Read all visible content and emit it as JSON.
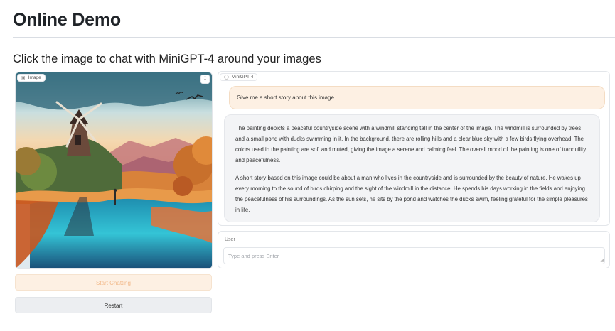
{
  "header": {
    "title": "Online Demo",
    "subtitle": "Click the image to chat with MiniGPT-4 around your images"
  },
  "image_panel": {
    "label": "Image",
    "label_icon": "image-icon",
    "download_icon": "download-icon"
  },
  "buttons": {
    "start": "Start Chatting",
    "restart": "Restart"
  },
  "chat": {
    "label": "MiniGPT-4",
    "label_icon": "chat-icon",
    "user_message": "Give me a short story about this image.",
    "bot_paragraphs": [
      "The painting depicts a peaceful countryside scene with a windmill standing tall in the center of the image. The windmill is surrounded by trees and a small pond with ducks swimming in it. In the background, there are rolling hills and a clear blue sky with a few birds flying overhead. The colors used in the painting are soft and muted, giving the image a serene and calming feel. The overall mood of the painting is one of tranquility and peacefulness.",
      "A short story based on this image could be about a man who lives in the countryside and is surrounded by the beauty of nature. He wakes up every morning to the sound of birds chirping and the sight of the windmill in the distance. He spends his days working in the fields and enjoying the peacefulness of his surroundings. As the sun sets, he sits by the pond and watches the ducks swim, feeling grateful for the simple pleasures in life."
    ]
  },
  "user_input": {
    "label": "User",
    "placeholder": "Type and press Enter",
    "value": ""
  },
  "colors": {
    "accent_orange_bg": "#fdf0e3",
    "accent_orange_text": "#f2b98a",
    "bot_bubble_bg": "#f3f4f6"
  }
}
